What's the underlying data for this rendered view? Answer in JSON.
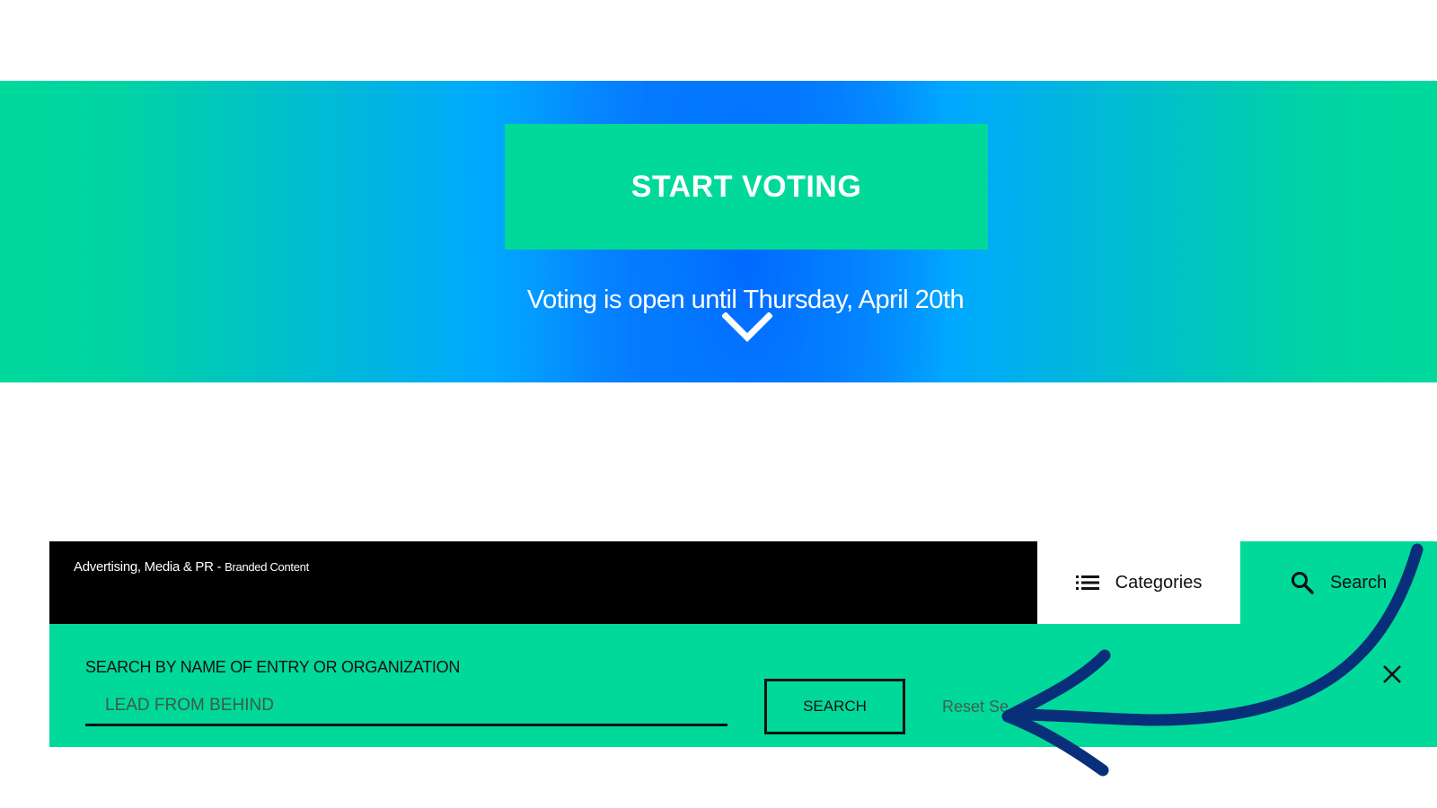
{
  "hero": {
    "start_label": "START VOTING",
    "note": "Voting is open until Thursday, April 20th"
  },
  "nav": {
    "category_main": "Advertising, Media & PR -",
    "category_sub": "Branded Content",
    "categories_label": "Categories",
    "search_label": "Search"
  },
  "search_panel": {
    "label": "SEARCH BY NAME OF ENTRY OR ORGANIZATION",
    "input_value": "LEAD FROM BEHIND",
    "search_button": "SEARCH",
    "reset_label": "Reset Se"
  },
  "icons": {
    "chevron": "chevron-down-icon",
    "categories": "list-icon",
    "search": "search-icon",
    "close": "close-icon",
    "annotation": "curved-arrow-annotation"
  },
  "colors": {
    "accent_green": "#00d999",
    "hero_blue": "#0b78ff",
    "nav_black": "#000000",
    "annotation_blue": "#0a2f7a"
  }
}
